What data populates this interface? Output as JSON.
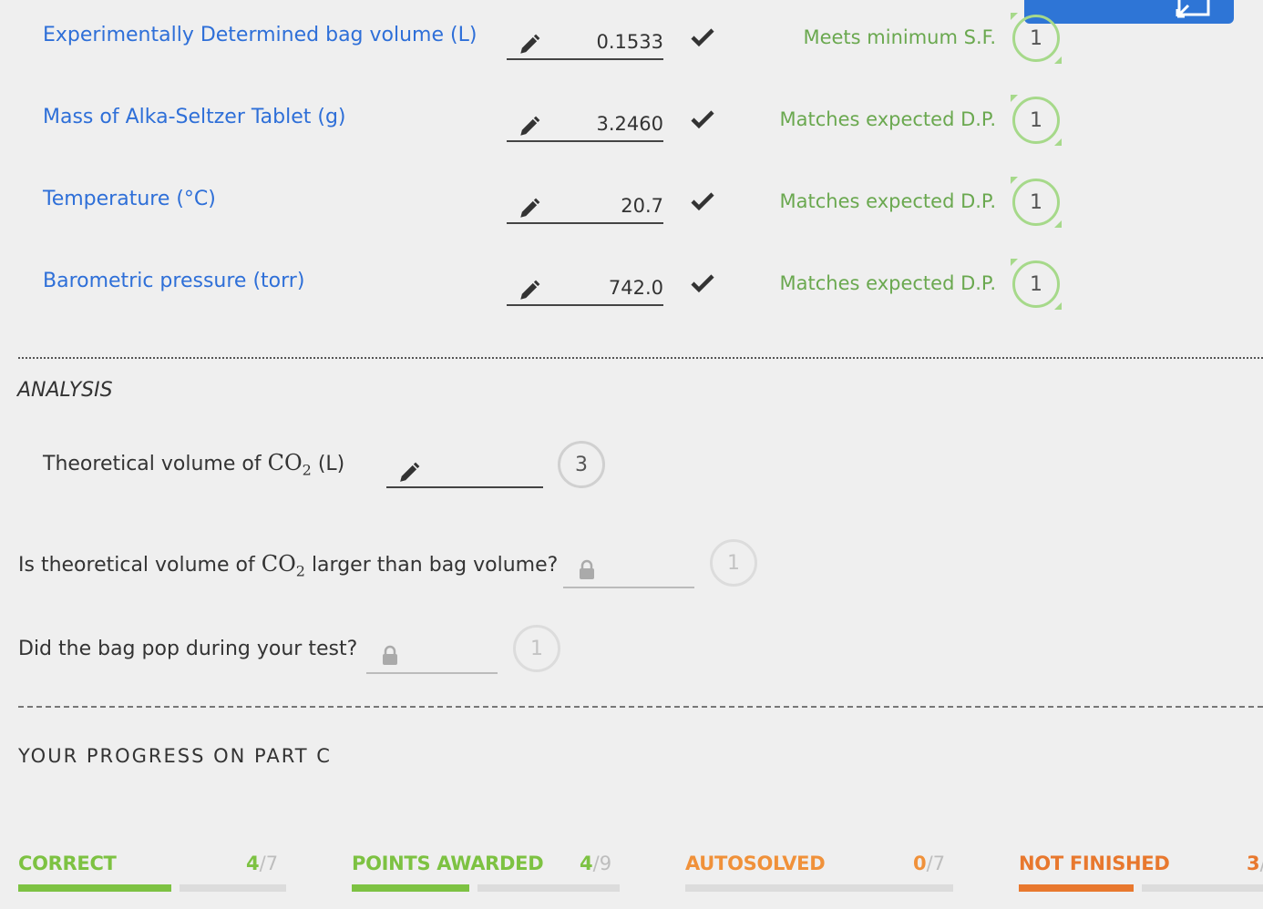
{
  "data_rows": [
    {
      "label": "Experimentally Determined bag volume (L)",
      "value": "0.1533",
      "status": "Meets minimum S.F.",
      "points": "1"
    },
    {
      "label": "Mass of Alka-Seltzer Tablet (g)",
      "value": "3.2460",
      "status": "Matches expected D.P.",
      "points": "1"
    },
    {
      "label": "Temperature (°C)",
      "value": "20.7",
      "status": "Matches expected D.P.",
      "points": "1"
    },
    {
      "label": "Barometric pressure (torr)",
      "value": "742.0",
      "status": "Matches expected D.P.",
      "points": "1"
    }
  ],
  "analysis": {
    "heading": "ANALYSIS",
    "theoretical": {
      "prefix": "Theoretical volume of ",
      "chem": "CO",
      "sub": "2",
      "suffix": " (L)",
      "points": "3"
    },
    "larger": {
      "prefix": "Is theoretical volume of ",
      "chem": "CO",
      "sub": "2",
      "suffix": " larger than bag volume?",
      "points": "1"
    },
    "pop": {
      "text": "Did the bag pop during your test?",
      "points": "1"
    }
  },
  "progress": {
    "title": "YOUR PROGRESS ON PART C",
    "items": [
      {
        "label": "CORRECT",
        "num": "4",
        "den": "/7",
        "color": "#7dc242",
        "fraction": 0.57
      },
      {
        "label": "POINTS AWARDED",
        "num": "4",
        "den": "/9",
        "color": "#7dc242",
        "fraction": 0.44
      },
      {
        "label": "AUTOSOLVED",
        "num": "0",
        "den": "/7",
        "color": "#f0913a",
        "fraction": 0.0
      },
      {
        "label": "NOT FINISHED",
        "num": "3",
        "den": "/",
        "color": "#e8782e",
        "fraction": 0.43
      }
    ]
  },
  "colors": {
    "link_blue": "#2e6fd8",
    "status_green": "#6aa84f",
    "button_blue": "#2e75d6"
  },
  "icons": [
    "pencil-icon",
    "check-icon",
    "lock-icon"
  ]
}
